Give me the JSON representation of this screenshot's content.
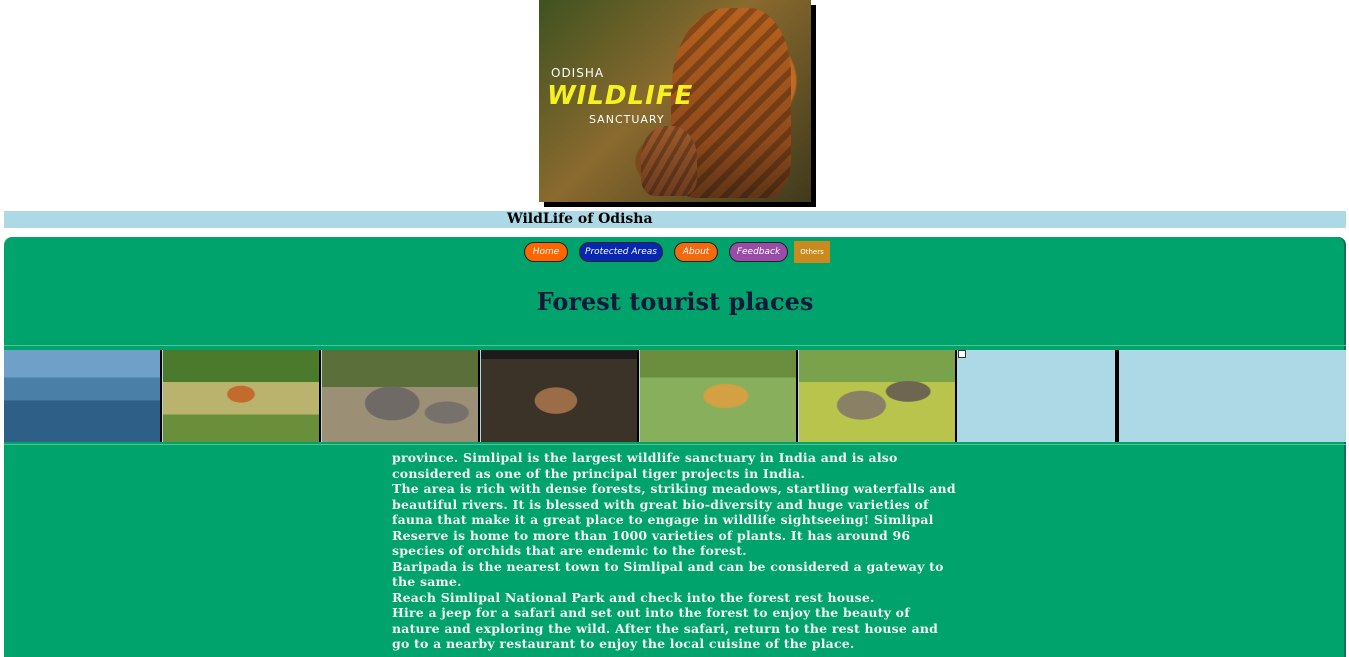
{
  "header": {
    "poster": {
      "line1": "ODISHA",
      "line2": "WILDLIFE",
      "line3": "SANCTUARY"
    }
  },
  "title_bar": {
    "title": "WildLife of Odisha"
  },
  "nav": {
    "items": [
      {
        "label": "Home",
        "color": "#ff6600"
      },
      {
        "label": "Protected Areas",
        "color": "#0726b2"
      },
      {
        "label": "About",
        "color": "#f26a0d"
      },
      {
        "label": "Feedback",
        "color": "#9a4ca8"
      },
      {
        "label": "Others",
        "color": "#c98b1f"
      }
    ]
  },
  "main": {
    "heading": "Forest tourist places",
    "gallery": [
      {
        "subject": "flamingos"
      },
      {
        "subject": "antelope"
      },
      {
        "subject": "elephants"
      },
      {
        "subject": "deer"
      },
      {
        "subject": "leopard"
      },
      {
        "subject": "crocodiles"
      },
      {
        "subject": "broken-image"
      }
    ],
    "paragraphs": [
      "province. Simlipal is the largest wildlife sanctuary in India and is also considered as one of the principal tiger projects in India.",
      "The area is rich with dense forests, striking meadows, startling waterfalls and beautiful rivers. It is blessed with great bio-diversity and huge varieties of fauna that make it a great place to engage in wildlife sightseeing! Simlipal Reserve is home to more than 1000 varieties of plants. It has around 96 species of orchids that are endemic to the forest.",
      "Baripada is the nearest town to Simlipal and can be considered a gateway to the same.",
      "Reach Simlipal National Park and check into the forest rest house.",
      "Hire a jeep for a safari and set out into the forest to enjoy the beauty of nature and exploring the wild. After the safari, return to the rest house and go to a nearby restaurant to enjoy the local cuisine of the place."
    ]
  },
  "colors": {
    "title_bar": "#add8e6",
    "main_bg": "#00a36c",
    "heading_text": "#0e1a3a"
  }
}
